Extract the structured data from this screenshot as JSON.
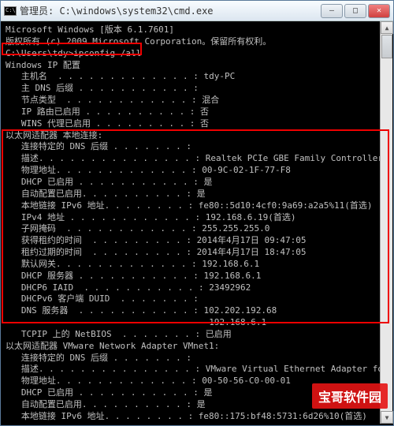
{
  "window": {
    "title": "管理员: C:\\windows\\system32\\cmd.exe",
    "min": "—",
    "max": "□",
    "close": "✕"
  },
  "lines": [
    "Microsoft Windows [版本 6.1.7601]",
    "版权所有 (c) 2009 Microsoft Corporation。保留所有权利。",
    "",
    "C:\\Users\\tdy>ipconfig /all",
    "",
    "Windows IP 配置",
    "",
    "   主机名  . . . . . . . . . . . . . : tdy-PC",
    "   主 DNS 后缀 . . . . . . . . . . . :",
    "   节点类型  . . . . . . . . . . . . : 混合",
    "   IP 路由已启用 . . . . . . . . . . : 否",
    "   WINS 代理已启用 . . . . . . . . . : 否",
    "",
    "以太网适配器 本地连接:",
    "",
    "   连接特定的 DNS 后缀 . . . . . . . :",
    "   描述. . . . . . . . . . . . . . . : Realtek PCIe GBE Family Controller",
    "   物理地址. . . . . . . . . . . . . : 00-9C-02-1F-77-F8",
    "   DHCP 已启用 . . . . . . . . . . . : 是",
    "   自动配置已启用. . . . . . . . . . : 是",
    "   本地链接 IPv6 地址. . . . . . . . : fe80::5d10:4cf0:9a69:a2a5%11(首选)",
    "   IPv4 地址 . . . . . . . . . . . . : 192.168.6.19(首选)",
    "   子网掩码  . . . . . . . . . . . . : 255.255.255.0",
    "   获得租约的时间  . . . . . . . . . : 2014年4月17日 09:47:05",
    "   租约过期的时间  . . . . . . . . . : 2014年4月17日 18:47:05",
    "   默认网关. . . . . . . . . . . . . : 192.168.6.1",
    "   DHCP 服务器 . . . . . . . . . . . : 192.168.6.1",
    "   DHCP6 IAID  . . . . . . . . . . . : 23492962",
    "   DHCPv6 客户端 DUID  . . . . . . . : ",
    "",
    "   DNS 服务器  . . . . . . . . . . . : 102.202.192.68",
    "                                       192.168.6.1",
    "   TCPIP 上的 NetBIOS  . . . . . . . : 已启用",
    "",
    "以太网适配器 VMware Network Adapter VMnet1:",
    "",
    "   连接特定的 DNS 后缀 . . . . . . . :",
    "   描述. . . . . . . . . . . . . . . : VMware Virtual Ethernet Adapter for VMnet",
    "   物理地址. . . . . . . . . . . . . : 00-50-56-C0-00-01",
    "   DHCP 已启用 . . . . . . . . . . . : 是",
    "   自动配置已启用. . . . . . . . . . : 是",
    "   本地链接 IPv6 地址. . . . . . . . : fe80::175:bf48:5731:6d26%10(首选)"
  ],
  "watermark": "宝哥软件园"
}
